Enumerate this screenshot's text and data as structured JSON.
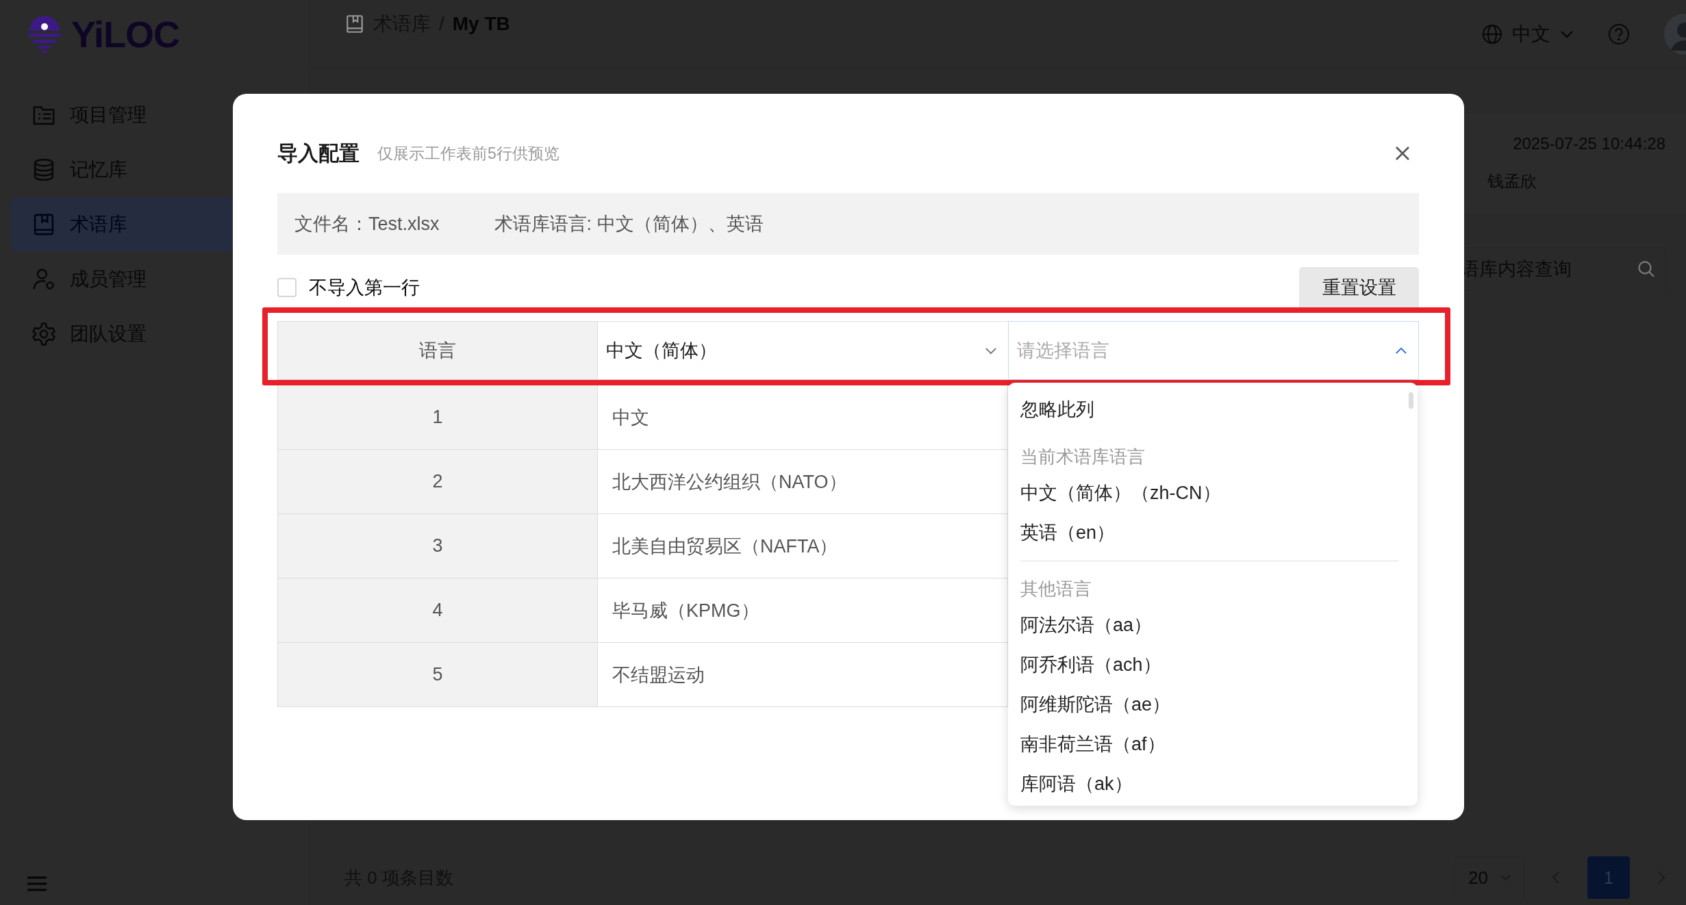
{
  "app": {
    "logo": "YiLOC"
  },
  "sidebar": {
    "items": [
      {
        "label": "项目管理",
        "selected": false
      },
      {
        "label": "记忆库",
        "selected": false
      },
      {
        "label": "术语库",
        "selected": true
      },
      {
        "label": "成员管理",
        "selected": false
      },
      {
        "label": "团队设置",
        "selected": false
      }
    ]
  },
  "breadcrumb": {
    "items": [
      "术语库",
      "My TB"
    ],
    "separator": "/"
  },
  "header": {
    "language": "中文"
  },
  "details": {
    "time": "2025-07-25 10:44:28",
    "owner": "钱孟欣",
    "search": {
      "placeholder": "语库内容查询"
    }
  },
  "footer": {
    "total": "共 0 项条目数",
    "page_size": "20",
    "pages": [
      {
        "label": "1",
        "selected": true
      }
    ]
  },
  "dialog": {
    "title": "导入配置",
    "hint": "仅展示工作表前5行供预览",
    "file_name": "文件名：Test.xlsx",
    "tb_languages": "术语库语言: 中文（简体）、英语",
    "skip_first_row": {
      "label": "不导入第一行",
      "checked": false
    },
    "reset_button": "重置设置",
    "mapping": {
      "header": "语言",
      "columns": [
        {
          "value": "中文（简体）",
          "open": false
        },
        {
          "placeholder": "请选择语言",
          "open": true
        }
      ]
    },
    "rows": [
      {
        "index": "1",
        "cells": [
          "中文"
        ]
      },
      {
        "index": "2",
        "cells": [
          "北大西洋公约组织（NATO）"
        ]
      },
      {
        "index": "3",
        "cells": [
          "北美自由贸易区（NAFTA）"
        ]
      },
      {
        "index": "4",
        "cells": [
          "毕马威（KPMG）"
        ]
      },
      {
        "index": "5",
        "cells": [
          "不结盟运动"
        ]
      }
    ],
    "dropdown": {
      "items": [
        {
          "kind": "option",
          "label": "忽略此列"
        },
        {
          "kind": "group",
          "label": "当前术语库语言"
        },
        {
          "kind": "option",
          "label": "中文（简体）（zh-CN）"
        },
        {
          "kind": "option",
          "label": "英语（en）"
        },
        {
          "kind": "divider"
        },
        {
          "kind": "group",
          "label": "其他语言"
        },
        {
          "kind": "option",
          "label": "阿法尔语（aa）"
        },
        {
          "kind": "option",
          "label": "阿乔利语（ach）"
        },
        {
          "kind": "option",
          "label": "阿维斯陀语（ae）"
        },
        {
          "kind": "option",
          "label": "南非荷兰语（af）"
        },
        {
          "kind": "option",
          "label": "库阿语（ak）"
        }
      ]
    }
  }
}
